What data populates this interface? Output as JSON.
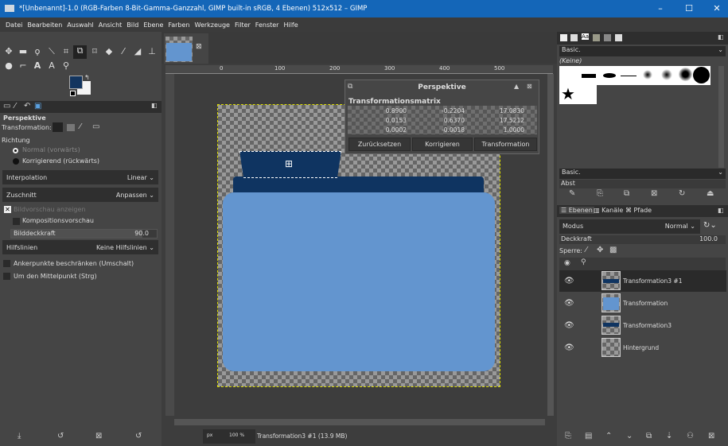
{
  "title": "*[Unbenannt]-1.0 (RGB-Farben 8-Bit-Gamma-Ganzzahl, GIMP built-in sRGB, 4 Ebenen) 512x512 – GIMP",
  "menu": [
    "Datei",
    "Bearbeiten",
    "Auswahl",
    "Ansicht",
    "Bild",
    "Ebene",
    "Farben",
    "Werkzeuge",
    "Filter",
    "Fenster",
    "Hilfe"
  ],
  "colors": {
    "foreground": "#13355f",
    "background": "#f4f4f4",
    "folder_light": "#6395cf",
    "folder_dark": "#0f3461"
  },
  "tool_options": {
    "title": "Perspektive",
    "transformation_label": "Transformation:",
    "direction_label": "Richtung",
    "direction_options": [
      "Normal (vorwärts)",
      "Korrigierend (rückwärts)"
    ],
    "direction_selected": 0,
    "interpolation_label": "Interpolation",
    "interpolation_value": "Linear",
    "clipping_label": "Zuschnitt",
    "clipping_value": "Anpassen",
    "show_preview": "Bildvorschau anzeigen",
    "show_preview_checked": true,
    "composite_preview": "Kompositionsvorschau",
    "composite_preview_checked": false,
    "opacity_label": "Bilddeckkraft",
    "opacity_value": "90.0",
    "guides_label": "Hilfslinien",
    "guides_value": "Keine Hilfslinien",
    "constrain": "Ankerpunkte beschränken (Umschalt)",
    "from_center": "Um den Mittelpunkt (Strg)"
  },
  "ruler": [
    "0",
    "100",
    "200",
    "300",
    "400",
    "500"
  ],
  "dialog": {
    "title": "Perspektive",
    "matrix_label": "Transformationsmatrix",
    "matrix": [
      [
        "0.8900",
        "-0.2204",
        "17.0830"
      ],
      [
        "0.0153",
        "0.6370",
        "17.5212"
      ],
      [
        "0.0002",
        "-0.0018",
        "1.0000"
      ]
    ],
    "buttons": [
      "Zurücksetzen",
      "Korrigieren",
      "Transformation"
    ]
  },
  "status": {
    "unit": "px",
    "zoom": "100 %",
    "info": "Transformation3 #1 (13.9 MB)"
  },
  "brushes": {
    "set": "Basic.",
    "current": "(Keine)",
    "tag": "Basic.",
    "spacing_label": "Abst"
  },
  "layers": {
    "tabs": [
      "Ebenen",
      "Kanäle",
      "Pfade"
    ],
    "mode_label": "Modus",
    "mode_value": "Normal",
    "opacity_label": "Deckkraft",
    "opacity_value": "100.0",
    "lock_label": "Sperre:",
    "items": [
      {
        "name": "Transformation3 #1",
        "selected": true
      },
      {
        "name": "Transformation"
      },
      {
        "name": "Transformation3"
      },
      {
        "name": "Hintergrund"
      }
    ]
  }
}
